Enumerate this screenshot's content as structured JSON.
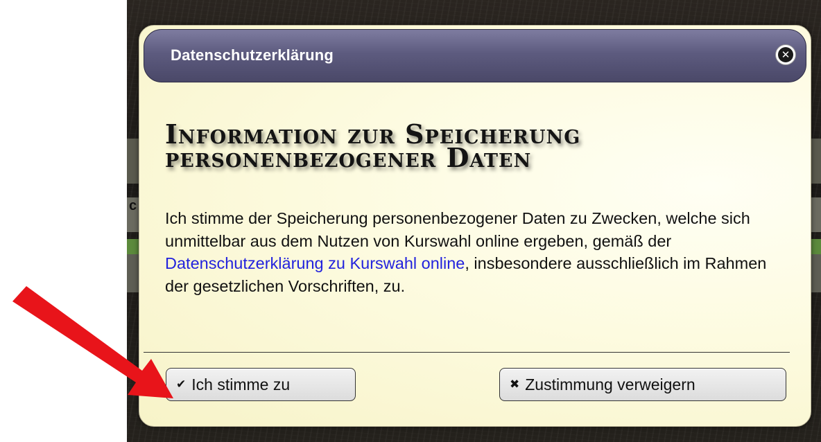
{
  "background": {
    "peek_text": "c"
  },
  "dialog": {
    "title": "Datenschutzerklärung",
    "close_icon": "close-icon",
    "heading": "Information zur Speicherung personenbezogener Daten",
    "body_before_link": "Ich stimme der Speicherung personenbezogener Daten zu Zwecken, welche sich unmittelbar aus dem Nutzen von Kurswahl online ergeben, gemäß der ",
    "body_link": "Datenschutzerklärung zu Kurswahl online",
    "body_after_link": ", insbesondere ausschließlich im Rahmen der gesetzlichen Vorschriften, zu.",
    "accept_button": {
      "icon": "check-icon",
      "label": "Ich stimme zu"
    },
    "decline_button": {
      "icon": "x-icon",
      "label": "Zustimmung verweigern"
    }
  },
  "colors": {
    "titlebar": "#5d5b7f",
    "dialog_background": "#fdfbe0",
    "link": "#2222dd",
    "arrow": "#e8141a"
  }
}
